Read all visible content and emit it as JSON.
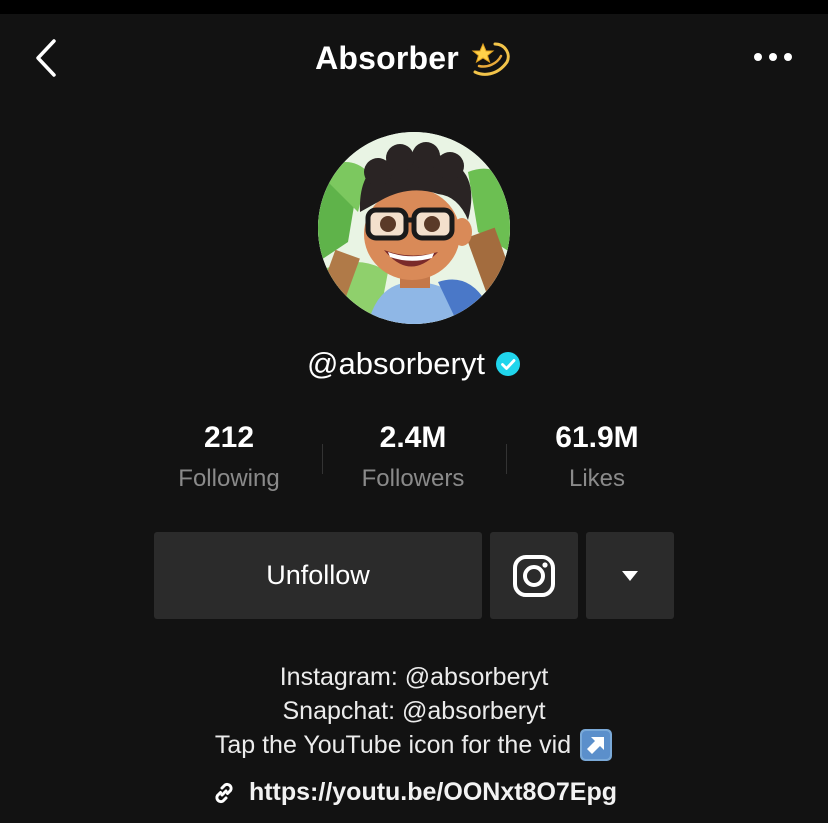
{
  "header": {
    "title": "Absorber",
    "title_emoji_icon": "dizzy-star-icon",
    "back_icon": "chevron-left-icon",
    "more_icon": "more-dots-icon"
  },
  "profile": {
    "username": "@absorberyt",
    "verified_icon": "verified-badge-icon"
  },
  "stats": [
    {
      "value": "212",
      "label": "Following"
    },
    {
      "value": "2.4M",
      "label": "Followers"
    },
    {
      "value": "61.9M",
      "label": "Likes"
    }
  ],
  "actions": {
    "unfollow_label": "Unfollow",
    "instagram_icon": "instagram-icon",
    "dropdown_icon": "caret-down-icon"
  },
  "bio": {
    "line1": "Instagram: @absorberyt",
    "line2": "Snapchat: @absorberyt",
    "line3": "Tap the YouTube icon for the vid",
    "line3_icon": "arrow-up-right-icon"
  },
  "link": {
    "icon": "link-icon",
    "url": "https://youtu.be/OONxt8O7Epg"
  },
  "colors": {
    "background": "#121212",
    "button": "#2b2b2b",
    "verified": "#20d5ec",
    "muted_text": "#8a8a8a"
  }
}
